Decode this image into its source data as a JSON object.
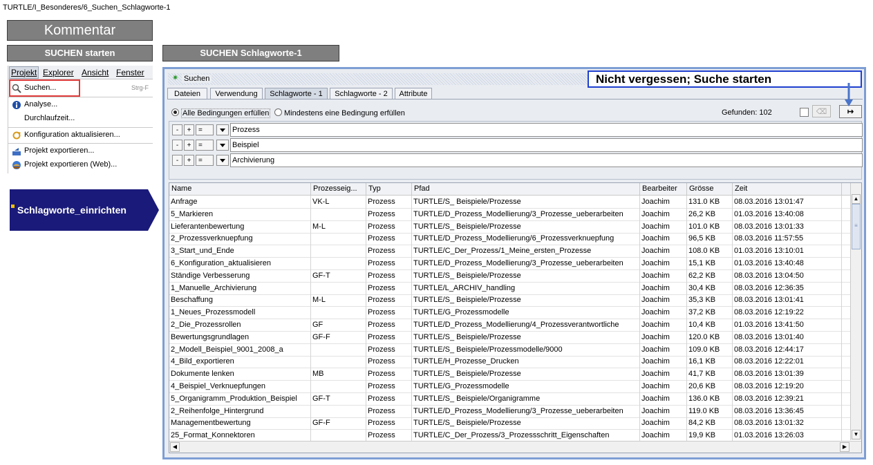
{
  "breadcrumb": "TURTLE/I_Besonderes/6_Suchen_Schlagworte-1",
  "buttons": {
    "kommentar": "Kommentar",
    "suchen_starten": "SUCHEN starten",
    "suchen_schlagworte": "SUCHEN Schlagworte-1"
  },
  "menu": {
    "bar": [
      "Projekt",
      "Explorer",
      "Ansicht",
      "Fenster"
    ],
    "items": [
      {
        "label": "Suchen...",
        "shortcut": "Strg-F",
        "icon": "magnifier-icon"
      },
      {
        "label": "Analyse...",
        "icon": "info-icon"
      },
      {
        "label": "Durchlaufzeit...",
        "icon": ""
      },
      {
        "label": "Konfiguration aktualisieren...",
        "icon": "refresh-config-icon"
      },
      {
        "label": "Projekt exportieren...",
        "icon": "export-icon"
      },
      {
        "label": "Projekt exportieren (Web)...",
        "icon": "export-web-icon"
      }
    ]
  },
  "schlagworte_arrow": "Schlagworte_einrichten",
  "callout": "Nicht vergessen; Suche starten",
  "window": {
    "title": "Suchen",
    "tabs": [
      "Dateien",
      "Verwendung",
      "Schlagworte - 1",
      "Schlagworte - 2",
      "Attribute"
    ],
    "active_tab": "Schlagworte - 1",
    "radio_all": "Alle Bedingungen erfüllen",
    "radio_any": "Mindestens eine Bedingung erfüllen",
    "found": "Gefunden: 102",
    "conditions": [
      {
        "minus": "-",
        "plus": "+",
        "op": "=",
        "value": "Prozess"
      },
      {
        "minus": "-",
        "plus": "+",
        "op": "=",
        "value": "Beispiel"
      },
      {
        "minus": "-",
        "plus": "+",
        "op": "=",
        "value": "Archivierung"
      }
    ],
    "columns": [
      "Name",
      "Prozesseig...",
      "Typ",
      "Pfad",
      "Bearbeiter",
      "Grösse",
      "Zeit"
    ],
    "rows": [
      [
        "Anfrage",
        "VK-L",
        "Prozess",
        "TURTLE/S_ Beispiele/Prozesse",
        "Joachim",
        "131.0 KB",
        "08.03.2016 13:01:47"
      ],
      [
        "5_Markieren",
        "",
        "Prozess",
        "TURTLE/D_Prozess_Modellierung/3_Prozesse_ueberarbeiten",
        "Joachim",
        "26,2 KB",
        "01.03.2016 13:40:08"
      ],
      [
        "Lieferantenbewertung",
        "M-L",
        "Prozess",
        "TURTLE/S_ Beispiele/Prozesse",
        "Joachim",
        "101.0 KB",
        "08.03.2016 13:01:33"
      ],
      [
        "2_Prozessverknuepfung",
        "",
        "Prozess",
        "TURTLE/D_Prozess_Modellierung/6_Prozessverknuepfung",
        "Joachim",
        "96,5 KB",
        "08.03.2016 11:57:55"
      ],
      [
        "3_Start_und_Ende",
        "",
        "Prozess",
        "TURTLE/C_Der_Prozess/1_Meine_ersten_Prozesse",
        "Joachim",
        "108.0 KB",
        "01.03.2016 13:10:01"
      ],
      [
        "6_Konfiguration_aktualisieren",
        "",
        "Prozess",
        "TURTLE/D_Prozess_Modellierung/3_Prozesse_ueberarbeiten",
        "Joachim",
        "15,1 KB",
        "01.03.2016 13:40:48"
      ],
      [
        "Ständige Verbesserung",
        "GF-T",
        "Prozess",
        "TURTLE/S_ Beispiele/Prozesse",
        "Joachim",
        "62,2 KB",
        "08.03.2016 13:04:50"
      ],
      [
        "1_Manuelle_Archivierung",
        "",
        "Prozess",
        "TURTLE/L_ARCHIV_handling",
        "Joachim",
        "30,4 KB",
        "08.03.2016 12:36:35"
      ],
      [
        "Beschaffung",
        "M-L",
        "Prozess",
        "TURTLE/S_ Beispiele/Prozesse",
        "Joachim",
        "35,3 KB",
        "08.03.2016 13:01:41"
      ],
      [
        "1_Neues_Prozessmodell",
        "",
        "Prozess",
        "TURTLE/G_Prozessmodelle",
        "Joachim",
        "37,2 KB",
        "08.03.2016 12:19:22"
      ],
      [
        "2_Die_Prozessrollen",
        "GF",
        "Prozess",
        "TURTLE/D_Prozess_Modellierung/4_Prozessverantwortliche",
        "Joachim",
        "10,4 KB",
        "01.03.2016 13:41:50"
      ],
      [
        "Bewertungsgrundlagen",
        "GF-F",
        "Prozess",
        "TURTLE/S_ Beispiele/Prozesse",
        "Joachim",
        "120.0 KB",
        "08.03.2016 13:01:40"
      ],
      [
        "2_Modell_Beispiel_9001_2008_a",
        "",
        "Prozess",
        "TURTLE/S_ Beispiele/Prozessmodelle/9000",
        "Joachim",
        "109.0 KB",
        "08.03.2016 12:44:17"
      ],
      [
        "4_Bild_exportieren",
        "",
        "Prozess",
        "TURTLE/H_Prozesse_Drucken",
        "Joachim",
        "16,1 KB",
        "08.03.2016 12:22:01"
      ],
      [
        "Dokumente lenken",
        "MB",
        "Prozess",
        "TURTLE/S_ Beispiele/Prozesse",
        "Joachim",
        "41,7 KB",
        "08.03.2016 13:01:39"
      ],
      [
        "4_Beispiel_Verknuepfungen",
        "",
        "Prozess",
        "TURTLE/G_Prozessmodelle",
        "Joachim",
        "20,6 KB",
        "08.03.2016 12:19:20"
      ],
      [
        "5_Organigramm_Produktion_Beispiel",
        "GF-T",
        "Prozess",
        "TURTLE/S_ Beispiele/Organigramme",
        "Joachim",
        "136.0 KB",
        "08.03.2016 12:39:21"
      ],
      [
        "2_Reihenfolge_Hintergrund",
        "",
        "Prozess",
        "TURTLE/D_Prozess_Modellierung/3_Prozesse_ueberarbeiten",
        "Joachim",
        "119.0 KB",
        "08.03.2016 13:36:45"
      ],
      [
        "Managementbewertung",
        "GF-F",
        "Prozess",
        "TURTLE/S_ Beispiele/Prozesse",
        "Joachim",
        "84,2 KB",
        "08.03.2016 13:01:32"
      ],
      [
        "25_Format_Konnektoren",
        "",
        "Prozess",
        "TURTLE/C_Der_Prozess/3_Prozessschritt_Eigenschaften",
        "Joachim",
        "19,9 KB",
        "01.03.2016 13:26:03"
      ]
    ]
  },
  "colors": {
    "callout_border": "#1e3fd0",
    "arrow_fill": "#1a1a7a",
    "menu_highlight": "#e03a3a",
    "window_border": "#7d9ed4"
  }
}
